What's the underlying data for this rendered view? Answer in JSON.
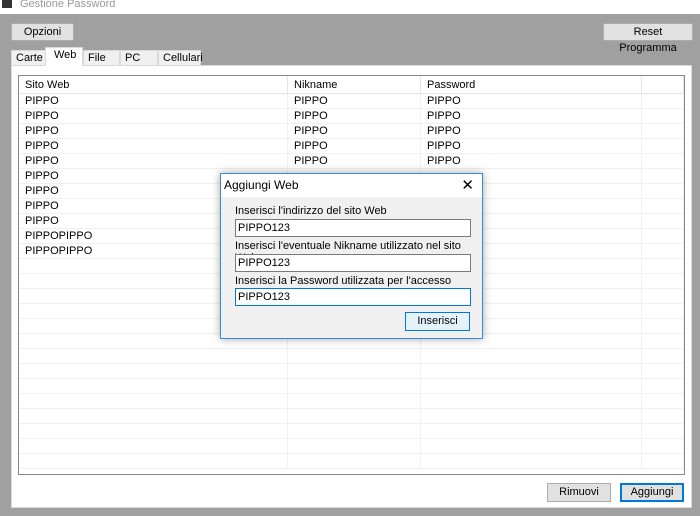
{
  "window": {
    "title": "Gestione Password"
  },
  "toolbar": {
    "options_label": "Opzioni",
    "reset_label": "Reset Programma"
  },
  "tabs": [
    {
      "label": "Carte"
    },
    {
      "label": "Web",
      "active": true
    },
    {
      "label": "File"
    },
    {
      "label": "PC"
    },
    {
      "label": "Cellulari"
    }
  ],
  "table": {
    "columns": [
      "Sito Web",
      "Nikname",
      "Password"
    ],
    "rows": [
      [
        "PIPPO",
        "PIPPO",
        "PIPPO"
      ],
      [
        "PIPPO",
        "PIPPO",
        "PIPPO"
      ],
      [
        "PIPPO",
        "PIPPO",
        "PIPPO"
      ],
      [
        "PIPPO",
        "PIPPO",
        "PIPPO"
      ],
      [
        "PIPPO",
        "PIPPO",
        "PIPPO"
      ],
      [
        "PIPPO",
        "",
        ""
      ],
      [
        "PIPPO",
        "",
        ""
      ],
      [
        "PIPPO",
        "",
        ""
      ],
      [
        "PIPPO",
        "",
        ""
      ],
      [
        "PIPPOPIPPO",
        "",
        ""
      ],
      [
        "PIPPOPIPPO",
        "",
        ""
      ]
    ]
  },
  "actions": {
    "remove_label": "Rimuovi",
    "add_label": "Aggiungi"
  },
  "dialog": {
    "title": "Aggiungi Web",
    "close_icon": "close-icon",
    "site_label": "Inserisci l'indirizzo del sito Web",
    "site_value": "PIPPO123",
    "nick_label": "Inserisci l'eventuale Nikname utilizzato nel sito Web",
    "nick_value": "PIPPO123",
    "pass_label": "Inserisci la Password utilizzata per l'accesso",
    "pass_value": "PIPPO123",
    "submit_label": "Inserisci"
  },
  "colors": {
    "accent": "#0078d7",
    "background": "#a0a0a0"
  }
}
